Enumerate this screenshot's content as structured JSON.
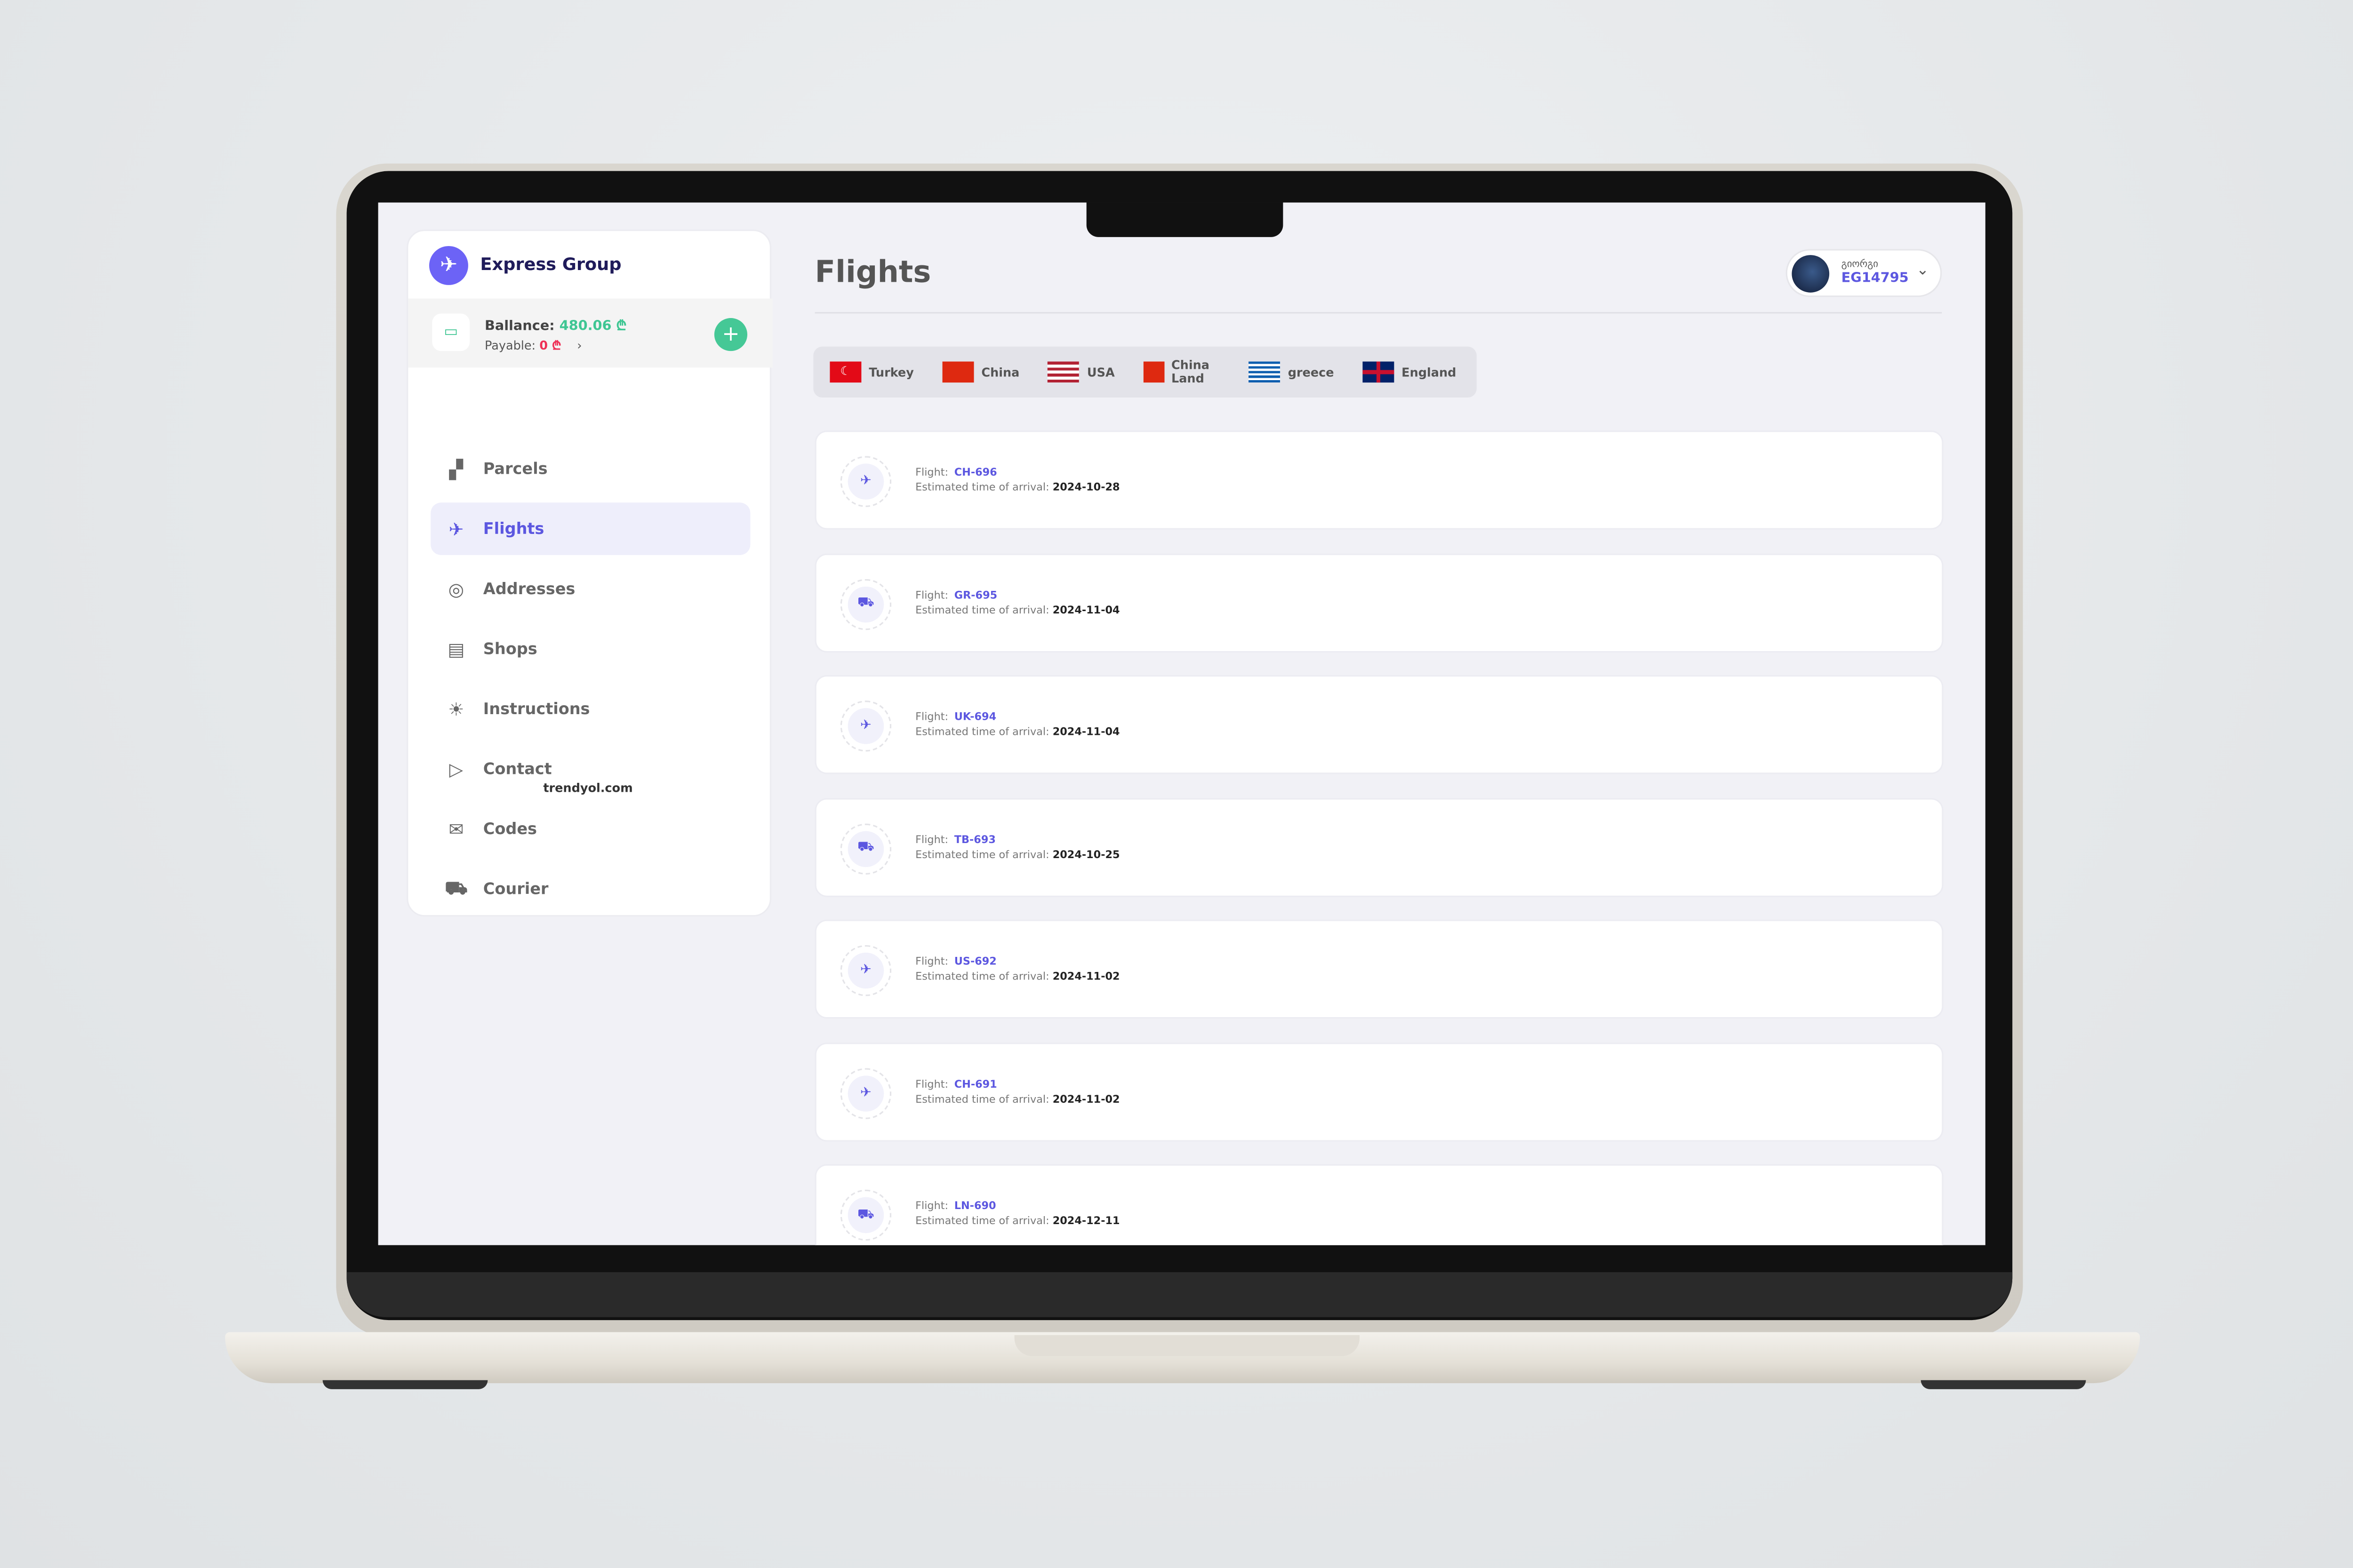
{
  "brand": {
    "name": "Express Group",
    "icon": "airplane-logo-icon",
    "accent": "#6c63f6"
  },
  "balance": {
    "label": "Ballance:",
    "value": "480.06 ₾",
    "payable_label": "Payable:",
    "payable_value": "0 ₾",
    "value_color": "#3fc693",
    "payable_color": "#ee3055"
  },
  "sidebar": {
    "items": [
      {
        "label": "Parcels",
        "icon": "boxes-icon"
      },
      {
        "label": "Flights",
        "icon": "airplane-icon",
        "active": true
      },
      {
        "label": "Addresses",
        "icon": "location-pin-icon"
      },
      {
        "label": "Shops",
        "icon": "store-icon"
      },
      {
        "label": "Instructions",
        "icon": "lightbulb-icon"
      },
      {
        "label": "Contact",
        "icon": "send-icon"
      },
      {
        "label": "Codes",
        "icon": "envelope-icon",
        "badge": "trendyol.com"
      },
      {
        "label": "Courier",
        "icon": "truck-icon"
      }
    ]
  },
  "header": {
    "title": "Flights",
    "user_name": "გიორგი",
    "user_id": "EG14795"
  },
  "countries": [
    "Turkey",
    "China",
    "USA",
    "China Land",
    "greece",
    "England"
  ],
  "flights": {
    "flight_label": "Flight:",
    "eta_label": "Estimated time of arrival:",
    "items": [
      {
        "code": "CH-696",
        "eta": "2024-10-28",
        "icon": "plane-landing-icon"
      },
      {
        "code": "GR-695",
        "eta": "2024-11-04",
        "icon": "truck-icon"
      },
      {
        "code": "UK-694",
        "eta": "2024-11-04",
        "icon": "plane-landing-icon"
      },
      {
        "code": "TB-693",
        "eta": "2024-10-25",
        "icon": "truck-icon"
      },
      {
        "code": "US-692",
        "eta": "2024-11-02",
        "icon": "plane-landing-icon"
      },
      {
        "code": "CH-691",
        "eta": "2024-11-02",
        "icon": "plane-landing-icon"
      },
      {
        "code": "LN-690",
        "eta": "2024-12-11",
        "icon": "truck-icon"
      }
    ]
  }
}
